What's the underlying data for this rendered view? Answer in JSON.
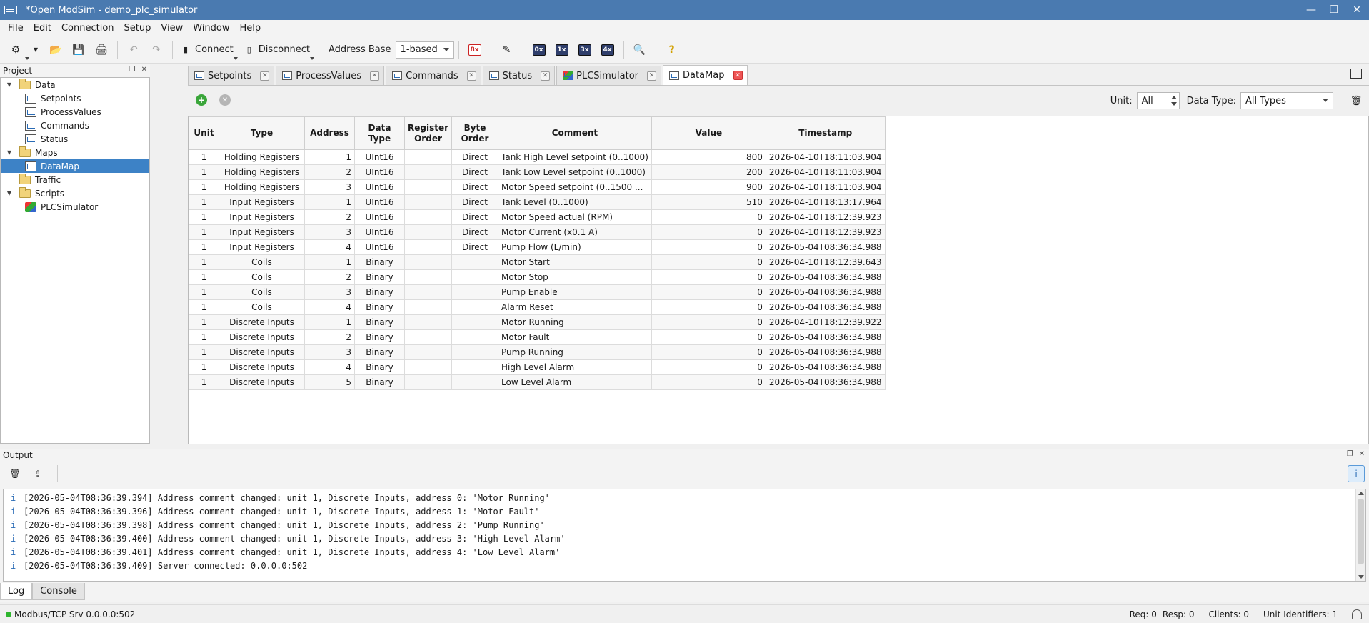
{
  "window": {
    "title": "*Open ModSim - demo_plc_simulator"
  },
  "menu": [
    "File",
    "Edit",
    "Connection",
    "Setup",
    "View",
    "Window",
    "Help"
  ],
  "toolbar": {
    "connect_label": "Connect",
    "disconnect_label": "Disconnect",
    "address_base_label": "Address Base",
    "address_base_value": "1-based",
    "reg_buttons": [
      "8x",
      "0x",
      "1x",
      "3x",
      "4x"
    ]
  },
  "project": {
    "header": "Project",
    "tree": [
      {
        "label": "Data",
        "type": "folder",
        "level": 0
      },
      {
        "label": "Setpoints",
        "type": "chart",
        "level": 1
      },
      {
        "label": "ProcessValues",
        "type": "chart",
        "level": 1
      },
      {
        "label": "Commands",
        "type": "chart",
        "level": 1
      },
      {
        "label": "Status",
        "type": "chart",
        "level": 1
      },
      {
        "label": "Maps",
        "type": "folder",
        "level": 0
      },
      {
        "label": "DataMap",
        "type": "chart",
        "level": 1,
        "selected": true
      },
      {
        "label": "Traffic",
        "type": "folder",
        "level": 0
      },
      {
        "label": "Scripts",
        "type": "folder",
        "level": 0
      },
      {
        "label": "PLCSimulator",
        "type": "script",
        "level": 1
      }
    ]
  },
  "tabs": [
    {
      "label": "Setpoints",
      "icon": "chart"
    },
    {
      "label": "ProcessValues",
      "icon": "chart"
    },
    {
      "label": "Commands",
      "icon": "chart"
    },
    {
      "label": "Status",
      "icon": "chart"
    },
    {
      "label": "PLCSimulator",
      "icon": "script"
    },
    {
      "label": "DataMap",
      "icon": "chart",
      "active": true
    }
  ],
  "filters": {
    "unit_label": "Unit:",
    "unit_value": "All",
    "data_type_label": "Data Type:",
    "data_type_value": "All Types"
  },
  "table": {
    "headers": [
      "Unit",
      "Type",
      "Address",
      "Data\nType",
      "Register\nOrder",
      "Byte\nOrder",
      "Comment",
      "Value",
      "Timestamp"
    ],
    "rows": [
      [
        "1",
        "Holding Registers",
        "1",
        "UInt16",
        "",
        "Direct",
        "Tank High Level setpoint (0..1000)",
        "800",
        "2026-04-10T18:11:03.904"
      ],
      [
        "1",
        "Holding Registers",
        "2",
        "UInt16",
        "",
        "Direct",
        "Tank Low Level setpoint (0..1000)",
        "200",
        "2026-04-10T18:11:03.904"
      ],
      [
        "1",
        "Holding Registers",
        "3",
        "UInt16",
        "",
        "Direct",
        "Motor Speed setpoint (0..1500 ...",
        "900",
        "2026-04-10T18:11:03.904"
      ],
      [
        "1",
        "Input Registers",
        "1",
        "UInt16",
        "",
        "Direct",
        "Tank Level (0..1000)",
        "510",
        "2026-04-10T18:13:17.964"
      ],
      [
        "1",
        "Input Registers",
        "2",
        "UInt16",
        "",
        "Direct",
        "Motor Speed actual (RPM)",
        "0",
        "2026-04-10T18:12:39.923"
      ],
      [
        "1",
        "Input Registers",
        "3",
        "UInt16",
        "",
        "Direct",
        "Motor Current (x0.1 A)",
        "0",
        "2026-04-10T18:12:39.923"
      ],
      [
        "1",
        "Input Registers",
        "4",
        "UInt16",
        "",
        "Direct",
        "Pump Flow (L/min)",
        "0",
        "2026-05-04T08:36:34.988"
      ],
      [
        "1",
        "Coils",
        "1",
        "Binary",
        "",
        "",
        "Motor Start",
        "0",
        "2026-04-10T18:12:39.643"
      ],
      [
        "1",
        "Coils",
        "2",
        "Binary",
        "",
        "",
        "Motor Stop",
        "0",
        "2026-05-04T08:36:34.988"
      ],
      [
        "1",
        "Coils",
        "3",
        "Binary",
        "",
        "",
        "Pump Enable",
        "0",
        "2026-05-04T08:36:34.988"
      ],
      [
        "1",
        "Coils",
        "4",
        "Binary",
        "",
        "",
        "Alarm Reset",
        "0",
        "2026-05-04T08:36:34.988"
      ],
      [
        "1",
        "Discrete Inputs",
        "1",
        "Binary",
        "",
        "",
        "Motor Running",
        "0",
        "2026-04-10T18:12:39.922"
      ],
      [
        "1",
        "Discrete Inputs",
        "2",
        "Binary",
        "",
        "",
        "Motor Fault",
        "0",
        "2026-05-04T08:36:34.988"
      ],
      [
        "1",
        "Discrete Inputs",
        "3",
        "Binary",
        "",
        "",
        "Pump Running",
        "0",
        "2026-05-04T08:36:34.988"
      ],
      [
        "1",
        "Discrete Inputs",
        "4",
        "Binary",
        "",
        "",
        "High Level Alarm",
        "0",
        "2026-05-04T08:36:34.988"
      ],
      [
        "1",
        "Discrete Inputs",
        "5",
        "Binary",
        "",
        "",
        "Low Level Alarm",
        "0",
        "2026-05-04T08:36:34.988"
      ]
    ]
  },
  "output": {
    "header": "Output",
    "lines": [
      "[2026-05-04T08:36:39.394] Address comment changed: unit 1, Discrete Inputs, address 0: 'Motor Running'",
      "[2026-05-04T08:36:39.396] Address comment changed: unit 1, Discrete Inputs, address 1: 'Motor Fault'",
      "[2026-05-04T08:36:39.398] Address comment changed: unit 1, Discrete Inputs, address 2: 'Pump Running'",
      "[2026-05-04T08:36:39.400] Address comment changed: unit 1, Discrete Inputs, address 3: 'High Level Alarm'",
      "[2026-05-04T08:36:39.401] Address comment changed: unit 1, Discrete Inputs, address 4: 'Low Level Alarm'",
      "[2026-05-04T08:36:39.409] Server connected: 0.0.0.0:502"
    ],
    "tabs": [
      "Log",
      "Console"
    ]
  },
  "status": {
    "connection": "Modbus/TCP Srv 0.0.0.0:502",
    "req": "Req: 0",
    "resp": "Resp: 0",
    "clients": "Clients: 0",
    "unit_ids": "Unit Identifiers: 1"
  }
}
